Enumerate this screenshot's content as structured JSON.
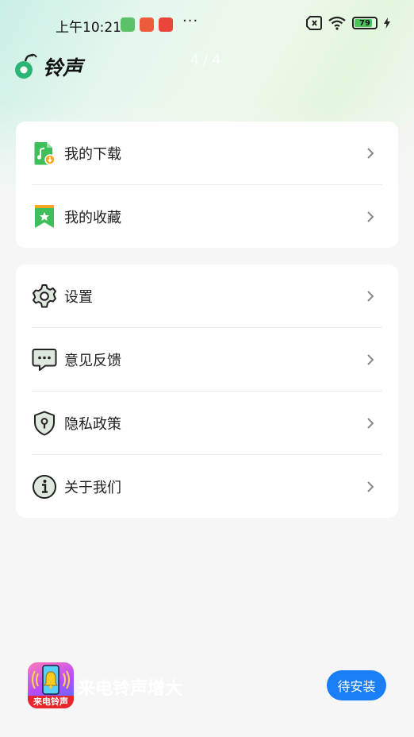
{
  "status_bar": {
    "time": "上午10:21",
    "more_dots": "···",
    "battery_level": "79"
  },
  "header": {
    "title": "铃声",
    "page_indicator": "4 / 4"
  },
  "menu_group_1": [
    {
      "label": "我的下载",
      "icon": "music-download-icon"
    },
    {
      "label": "我的收藏",
      "icon": "bookmark-star-icon"
    }
  ],
  "menu_group_2": [
    {
      "label": "设置",
      "icon": "gear-icon"
    },
    {
      "label": "意见反馈",
      "icon": "chat-bubble-icon"
    },
    {
      "label": "隐私政策",
      "icon": "shield-lock-icon"
    },
    {
      "label": "关于我们",
      "icon": "info-icon"
    }
  ],
  "ad": {
    "app_icon_label": "来电铃声",
    "app_name": "来电铃声增大",
    "install_label": "待安装"
  },
  "colors": {
    "accent_green": "#4cc65a",
    "install_blue": "#1a7ef6",
    "ad_red": "#e8262b"
  }
}
